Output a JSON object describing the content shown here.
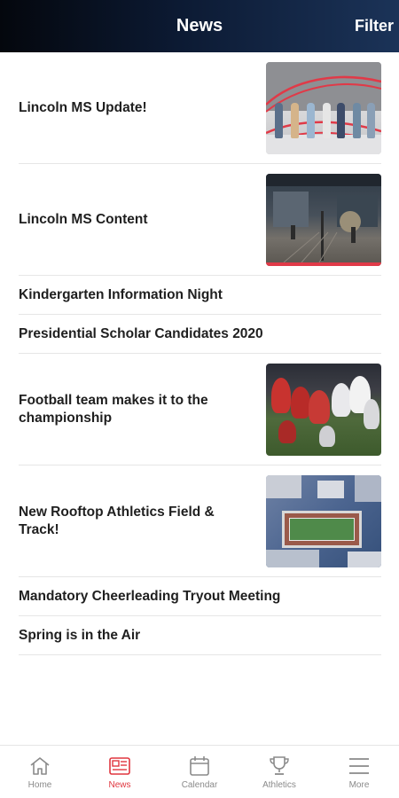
{
  "header": {
    "title": "News",
    "filter_label": "Filter"
  },
  "news": [
    {
      "title": "Lincoln MS Update!",
      "has_image": true,
      "image": "students-photo"
    },
    {
      "title": "Lincoln MS Content",
      "has_image": true,
      "image": "building-photo"
    },
    {
      "title": "Kindergarten Information Night",
      "has_image": false
    },
    {
      "title": "Presidential Scholar Candidates 2020",
      "has_image": false
    },
    {
      "title": "Football team makes it to the championship",
      "has_image": true,
      "image": "football-photo"
    },
    {
      "title": "New Rooftop Athletics Field & Track!",
      "has_image": true,
      "image": "rooftop-field-photo"
    },
    {
      "title": "Mandatory Cheerleading Tryout Meeting",
      "has_image": false
    },
    {
      "title": "Spring is in the Air",
      "has_image": false
    }
  ],
  "tabs": [
    {
      "label": "Home",
      "icon": "home-icon",
      "active": false
    },
    {
      "label": "News",
      "icon": "news-icon",
      "active": true
    },
    {
      "label": "Calendar",
      "icon": "calendar-icon",
      "active": false
    },
    {
      "label": "Athletics",
      "icon": "trophy-icon",
      "active": false
    },
    {
      "label": "More",
      "icon": "menu-icon",
      "active": false
    }
  ],
  "colors": {
    "accent": "#e0363f",
    "header_dark": "#04070d",
    "header_light": "#1b3358",
    "tab_inactive": "#8a8a8a"
  }
}
